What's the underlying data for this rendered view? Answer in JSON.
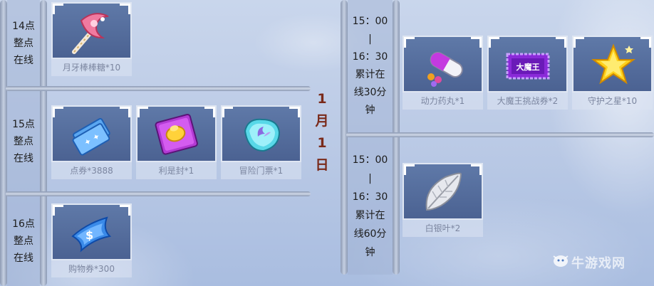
{
  "left_panel": {
    "rows": [
      {
        "time_lines": [
          "14点",
          "整点",
          "在线"
        ],
        "items": [
          {
            "icon": "crescent-lollipop-icon",
            "label": "月牙棒棒糖*10"
          }
        ]
      },
      {
        "time_lines": [
          "15点",
          "整点",
          "在线"
        ],
        "items": [
          {
            "icon": "vouchers-icon",
            "label": "点券*3888"
          },
          {
            "icon": "red-envelope-icon",
            "label": "利是封*1"
          },
          {
            "icon": "adventure-ticket-stone-icon",
            "label": "冒险门票*1"
          }
        ]
      },
      {
        "time_lines": [
          "16点",
          "整点",
          "在线"
        ],
        "items": [
          {
            "icon": "shopping-coupon-icon",
            "label": "购物券*300"
          }
        ]
      }
    ]
  },
  "date_label": [
    "1",
    "月",
    "1",
    "日"
  ],
  "right_panel": {
    "rows": [
      {
        "time_lines": [
          "15：00",
          "|",
          "16：30",
          "累计在",
          "线30分",
          "钟"
        ],
        "items": [
          {
            "icon": "power-pill-icon",
            "label": "动力药丸*1"
          },
          {
            "icon": "demon-king-ticket-icon",
            "label": "大魔王挑战券*2",
            "badge_text": "大魔王"
          },
          {
            "icon": "guardian-star-icon",
            "label": "守护之星*10"
          }
        ]
      },
      {
        "time_lines": [
          "15：00",
          "|",
          "16：30",
          "累计在",
          "线60分",
          "钟"
        ],
        "items": [
          {
            "icon": "silver-leaf-icon",
            "label": "白银叶*2"
          }
        ]
      }
    ]
  },
  "watermark": "牛游戏网"
}
